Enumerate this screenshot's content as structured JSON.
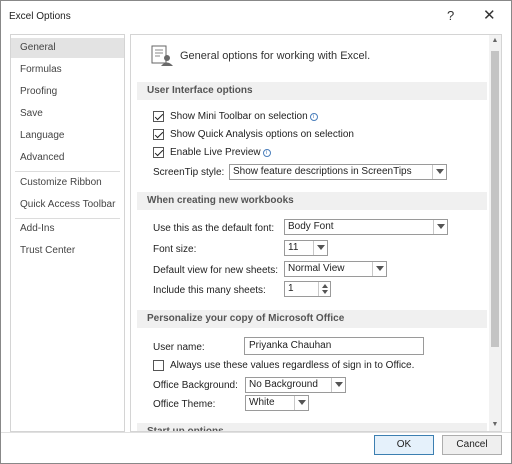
{
  "window": {
    "title": "Excel Options",
    "help": "?",
    "close": "✕"
  },
  "sidebar": {
    "items": [
      {
        "label": "General"
      },
      {
        "label": "Formulas"
      },
      {
        "label": "Proofing"
      },
      {
        "label": "Save"
      },
      {
        "label": "Language"
      },
      {
        "label": "Advanced"
      },
      {
        "label": "Customize Ribbon"
      },
      {
        "label": "Quick Access Toolbar"
      },
      {
        "label": "Add-Ins"
      },
      {
        "label": "Trust Center"
      }
    ],
    "selected": "General"
  },
  "header": {
    "text": "General options for working with Excel."
  },
  "ui_options": {
    "title": "User Interface options",
    "mini_toolbar": {
      "label": "Show Mini Toolbar on selection",
      "checked": true
    },
    "quick_analysis": {
      "label": "Show Quick Analysis options on selection",
      "checked": true
    },
    "live_preview": {
      "label": "Enable Live Preview",
      "checked": true
    },
    "screentip_label": "ScreenTip style:",
    "screentip_value": "Show feature descriptions in ScreenTips"
  },
  "new_workbooks": {
    "title": "When creating new workbooks",
    "font_label": "Use this as the default font:",
    "font_value": "Body Font",
    "size_label": "Font size:",
    "size_value": "11",
    "view_label": "Default view for new sheets:",
    "view_value": "Normal View",
    "sheets_label": "Include this many sheets:",
    "sheets_value": "1"
  },
  "personalize": {
    "title": "Personalize your copy of Microsoft Office",
    "username_label": "User name:",
    "username_value": "Priyanka Chauhan",
    "always_use": {
      "label": "Always use these values regardless of sign in to Office.",
      "checked": false
    },
    "background_label": "Office Background:",
    "background_value": "No Background",
    "theme_label": "Office Theme:",
    "theme_value": "White"
  },
  "startup": {
    "title": "Start up options"
  },
  "buttons": {
    "ok": "OK",
    "cancel": "Cancel"
  },
  "colors": {
    "selected_nav": "#e3e3e3",
    "section_bg": "#f0f0f0",
    "default_button_border": "#3c7fb1"
  }
}
